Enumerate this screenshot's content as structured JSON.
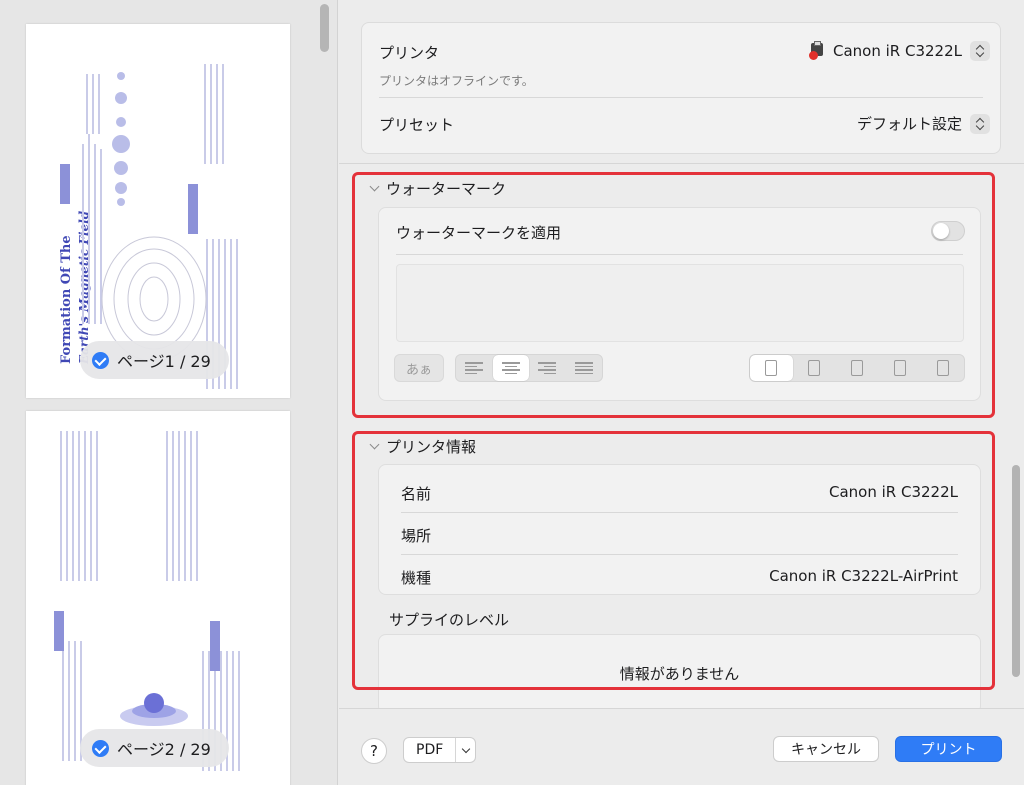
{
  "preview": {
    "pages": [
      {
        "label": "ページ1 / 29",
        "doc_title_lines": [
          "Formation Of The",
          "Earth's Magnetic Field"
        ]
      },
      {
        "label": "ページ2 / 29"
      }
    ]
  },
  "printer": {
    "label": "プリンタ",
    "value": "Canon iR C3222L",
    "status": "プリンタはオフラインです。",
    "icon": "printer-offline-icon"
  },
  "preset": {
    "label": "プリセット",
    "value": "デフォルト設定"
  },
  "watermark": {
    "title": "ウォーターマーク",
    "apply_label": "ウォーターマークを適用",
    "apply_on": false,
    "font_button": "あぁ",
    "text_value": ""
  },
  "printer_info": {
    "title": "プリンタ情報",
    "rows": [
      {
        "label": "名前",
        "value": "Canon iR C3222L"
      },
      {
        "label": "場所",
        "value": ""
      },
      {
        "label": "機種",
        "value": "Canon iR C3222L-AirPrint"
      }
    ],
    "supply_title": "サプライのレベル",
    "supply_message": "情報がありません"
  },
  "footer": {
    "help": "?",
    "pdf": "PDF",
    "cancel": "キャンセル",
    "print": "プリント"
  },
  "colors": {
    "accent": "#2f7cf6",
    "highlight": "#e4323a"
  }
}
